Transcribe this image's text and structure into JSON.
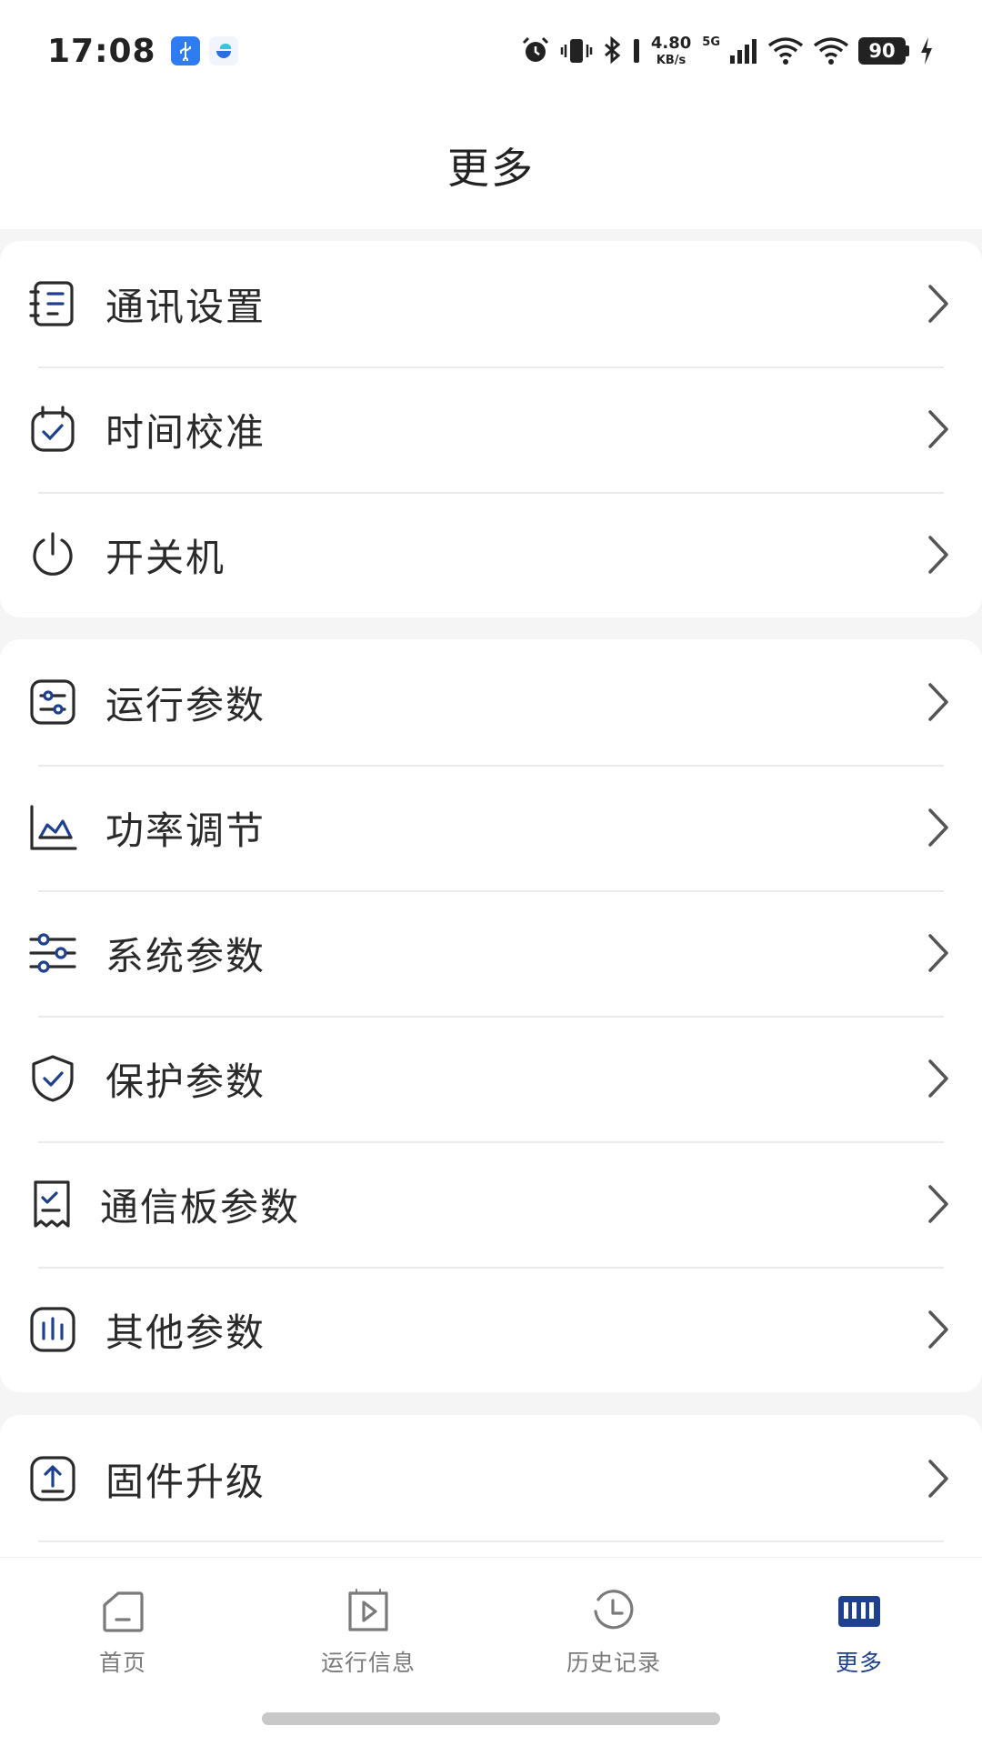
{
  "status_bar": {
    "time": "17:08",
    "net_speed": "4.80",
    "net_unit": "KB/s",
    "network_type": "5G",
    "battery": "90"
  },
  "header": {
    "title": "更多"
  },
  "groups": [
    {
      "items": [
        {
          "label": "通讯设置",
          "icon": "notebook-list-icon"
        },
        {
          "label": "时间校准",
          "icon": "calendar-check-icon"
        },
        {
          "label": "开关机",
          "icon": "power-icon"
        }
      ]
    },
    {
      "items": [
        {
          "label": "运行参数",
          "icon": "adjust-sliders-box-icon"
        },
        {
          "label": "功率调节",
          "icon": "area-chart-icon"
        },
        {
          "label": "系统参数",
          "icon": "sliders-icon"
        },
        {
          "label": "保护参数",
          "icon": "shield-check-icon"
        },
        {
          "label": "通信板参数",
          "icon": "receipt-check-icon"
        },
        {
          "label": "其他参数",
          "icon": "bar-chart-box-icon"
        }
      ]
    },
    {
      "items": [
        {
          "label": "固件升级",
          "icon": "upload-box-icon"
        }
      ]
    }
  ],
  "bottom_nav": {
    "items": [
      {
        "label": "首页",
        "icon": "home-icon"
      },
      {
        "label": "运行信息",
        "icon": "play-box-icon"
      },
      {
        "label": "历史记录",
        "icon": "clock-icon"
      },
      {
        "label": "更多",
        "icon": "more-grid-icon",
        "active": true
      }
    ]
  },
  "colors": {
    "accent": "#1f3f8f",
    "icon_dark": "#2b2b2b",
    "label_inactive": "#7a7a7a",
    "background": "#f5f5f5"
  }
}
